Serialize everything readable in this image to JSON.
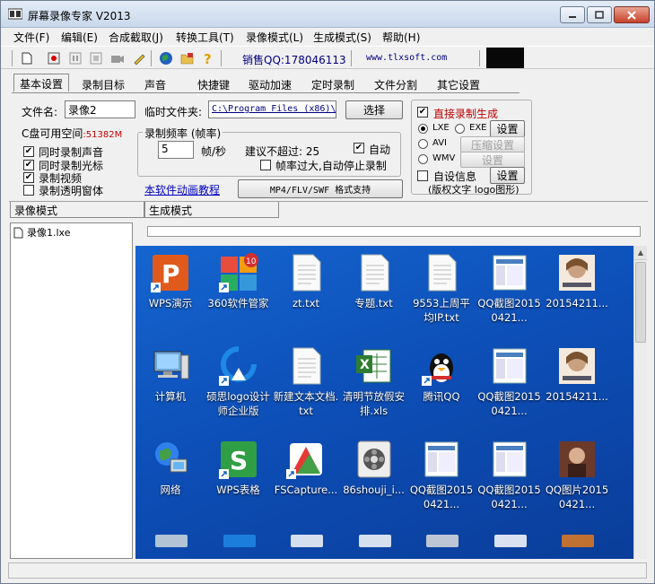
{
  "window": {
    "title": "屏幕录像专家 V2013"
  },
  "menu": [
    "文件(F)",
    "编辑(E)",
    "合成截取(J)",
    "转换工具(T)",
    "录像模式(L)",
    "生成模式(S)",
    "帮助(H)"
  ],
  "toolbar": {
    "sales": "销售QQ:178046113",
    "website": "www.tlxsoft.com"
  },
  "tabs": [
    "基本设置",
    "录制目标",
    "声音",
    "快捷键",
    "驱动加速",
    "定时录制",
    "文件分割",
    "其它设置"
  ],
  "basic": {
    "filename_label": "文件名:",
    "filename_value": "录像2",
    "tempfolder_label": "临时文件夹:",
    "tempfolder_value": "C:\\Program Files (x86)\\",
    "choose_button": "选择",
    "disk_label": "C盘可用空间",
    "disk_value": ":51382M",
    "checks": [
      {
        "label": "同时录制声音",
        "checked": true
      },
      {
        "label": "同时录制光标",
        "checked": true
      },
      {
        "label": "录制视频",
        "checked": true
      },
      {
        "label": "录制透明窗体",
        "checked": false
      }
    ],
    "rate_group": "录制频率 (帧率)",
    "rate_value": "5",
    "rate_unit": "帧/秒",
    "suggest": "建议不超过: 25",
    "auto_label": "自动",
    "auto_stop": "帧率过大,自动停止录制",
    "tutorial_link": "本软件动画教程",
    "format_button": "MP4/FLV/SWF  格式支持"
  },
  "generate": {
    "direct_label": "直接录制生成",
    "lxe": "LXE",
    "exe": "EXE",
    "avi": "AVI",
    "wmv": "WMV",
    "settings": "设置",
    "compress": "压缩设置",
    "custom_info": "自设信息",
    "copyright": "(版权文字 logo图形)"
  },
  "lower": {
    "mode_tab1": "录像模式",
    "mode_tab2": "生成模式",
    "file_item": "录像1.lxe"
  },
  "desktop": {
    "icons": [
      {
        "label": "WPS演示",
        "kind": "wps-p"
      },
      {
        "label": "360软件管家",
        "kind": "grid360"
      },
      {
        "label": "zt.txt",
        "kind": "txt"
      },
      {
        "label": "专题.txt",
        "kind": "txt"
      },
      {
        "label": "9553上周平均IP.txt",
        "kind": "txt"
      },
      {
        "label": "QQ截图20150421...",
        "kind": "shot"
      },
      {
        "label": "20154211...",
        "kind": "photo"
      },
      {
        "label": "计算机",
        "kind": "pc"
      },
      {
        "label": "硕思logo设计师企业版",
        "kind": "logo"
      },
      {
        "label": "新建文本文档.txt",
        "kind": "txt"
      },
      {
        "label": "清明节放假安排.xls",
        "kind": "xls"
      },
      {
        "label": "腾讯QQ",
        "kind": "qq"
      },
      {
        "label": "QQ截图20150421...",
        "kind": "shot"
      },
      {
        "label": "20154211...",
        "kind": "photo"
      },
      {
        "label": "网络",
        "kind": "net"
      },
      {
        "label": "WPS表格",
        "kind": "wps-s"
      },
      {
        "label": "FSCapture...",
        "kind": "fs"
      },
      {
        "label": "86shouji_i...",
        "kind": "film"
      },
      {
        "label": "QQ截图20150421...",
        "kind": "shot"
      },
      {
        "label": "QQ截图20150421...",
        "kind": "shot"
      },
      {
        "label": "QQ图片20150421...",
        "kind": "photo2"
      }
    ],
    "badge": "10"
  },
  "colors": {
    "disk_value": "#c00000",
    "link": "#0000c0",
    "sales": "#000080",
    "desktop": "#1565d0"
  }
}
